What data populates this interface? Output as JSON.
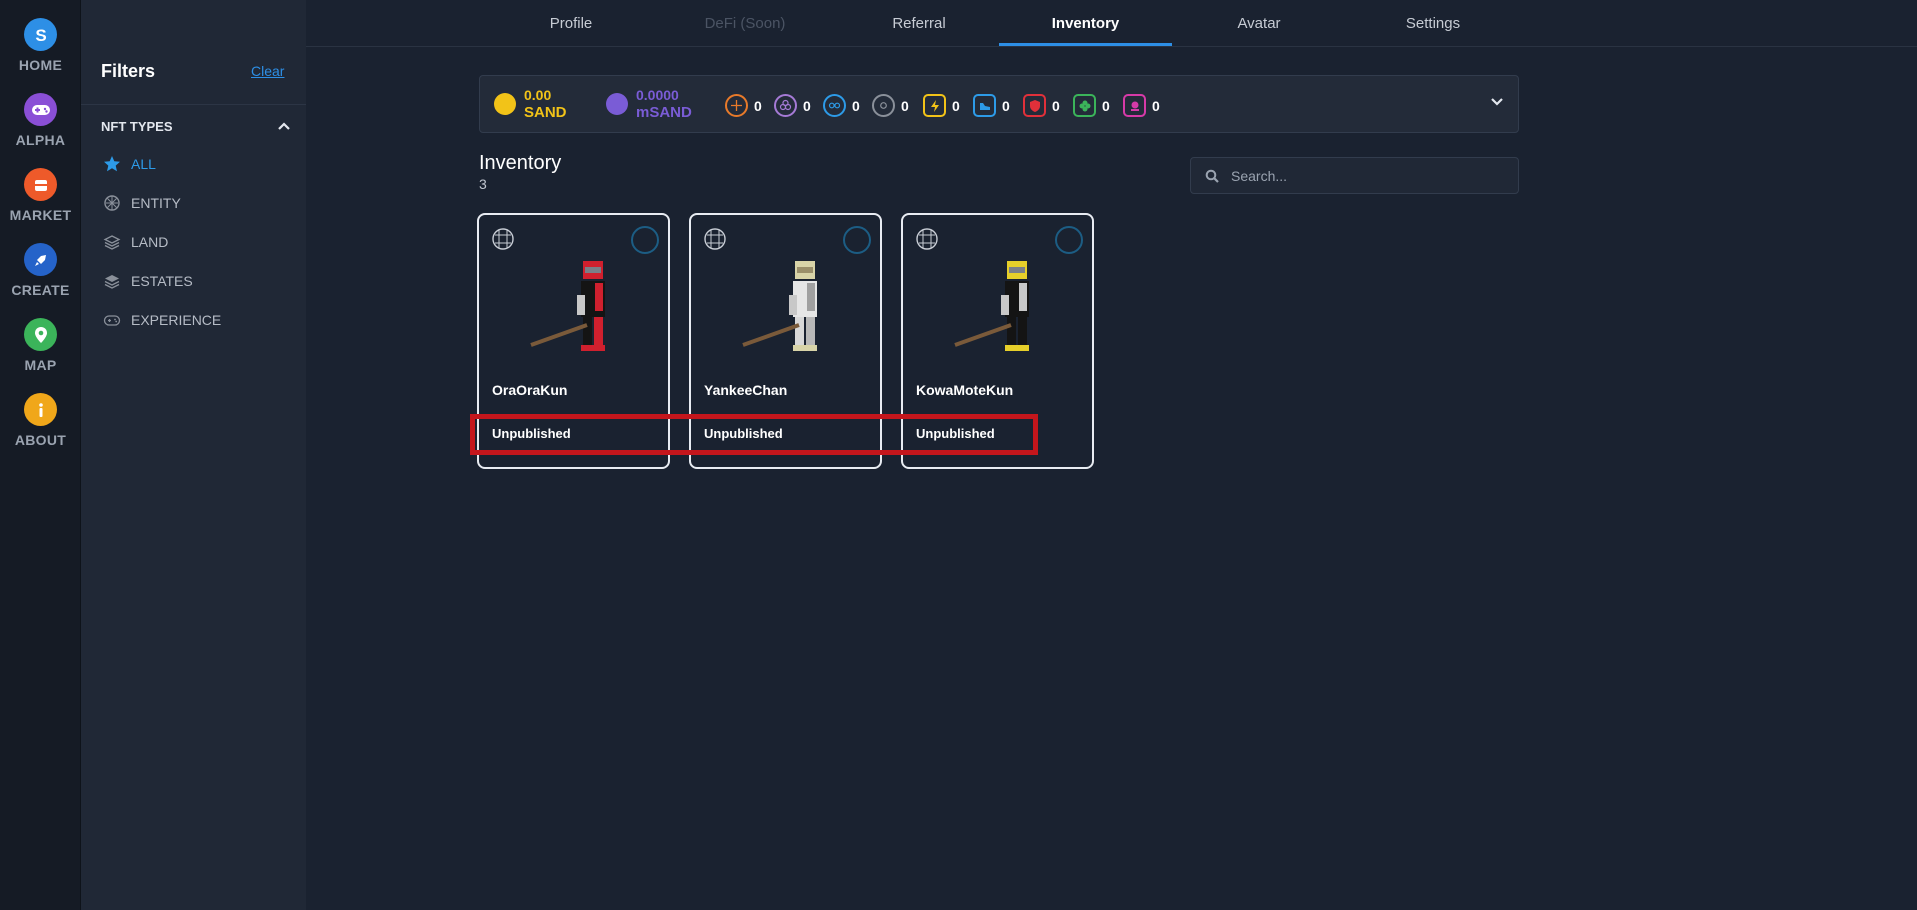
{
  "rail": {
    "items": [
      {
        "label": "HOME",
        "icon": "sandbox-logo-icon",
        "color": "#2d8fe6"
      },
      {
        "label": "ALPHA",
        "icon": "gamepad-icon",
        "color": "#8a4fd6"
      },
      {
        "label": "MARKET",
        "icon": "shop-icon",
        "color": "#ee5a2a"
      },
      {
        "label": "CREATE",
        "icon": "rocket-icon",
        "color": "#2563c9"
      },
      {
        "label": "MAP",
        "icon": "map-pin-icon",
        "color": "#3bb45a"
      },
      {
        "label": "ABOUT",
        "icon": "info-icon",
        "color": "#f0a71a"
      }
    ]
  },
  "filters": {
    "title": "Filters",
    "clear_label": "Clear",
    "section_title": "NFT TYPES",
    "types": [
      {
        "label": "ALL",
        "icon": "star-icon",
        "active": true
      },
      {
        "label": "ENTITY",
        "icon": "entity-icon",
        "active": false
      },
      {
        "label": "LAND",
        "icon": "land-icon",
        "active": false
      },
      {
        "label": "ESTATES",
        "icon": "estates-icon",
        "active": false
      },
      {
        "label": "EXPERIENCE",
        "icon": "gamepad-icon",
        "active": false
      }
    ]
  },
  "tabs": [
    {
      "label": "Profile",
      "state": "normal"
    },
    {
      "label": "DeFi (Soon)",
      "state": "disabled"
    },
    {
      "label": "Referral",
      "state": "normal"
    },
    {
      "label": "Inventory",
      "state": "active"
    },
    {
      "label": "Avatar",
      "state": "normal"
    },
    {
      "label": "Settings",
      "state": "normal"
    }
  ],
  "balance": {
    "sand_amount": "0.00",
    "sand_unit": "SAND",
    "sand_color": "#f2c318",
    "msand_amount": "0.0000",
    "msand_unit": "mSAND",
    "msand_color": "#7a5cd6",
    "gems": [
      {
        "icon": "orange-gem-icon",
        "color": "#e87a2a",
        "count": "0"
      },
      {
        "icon": "purple-gem-icon",
        "color": "#a57ad6",
        "count": "0"
      },
      {
        "icon": "blue-gem-icon",
        "color": "#2d9be8",
        "count": "0"
      },
      {
        "icon": "grey-gem-icon",
        "color": "#8a909a",
        "count": "0"
      },
      {
        "icon": "lightning-catalyst-icon",
        "color": "#f2c318",
        "count": "0"
      },
      {
        "icon": "shoe-catalyst-icon",
        "color": "#2d9be8",
        "count": "0"
      },
      {
        "icon": "shield-catalyst-icon",
        "color": "#e0303a",
        "count": "0"
      },
      {
        "icon": "clover-catalyst-icon",
        "color": "#3bb45a",
        "count": "0"
      },
      {
        "icon": "magic-catalyst-icon",
        "color": "#d63aa8",
        "count": "0"
      }
    ]
  },
  "inventory": {
    "title": "Inventory",
    "count": "3",
    "search_placeholder": "Search...",
    "items": [
      {
        "name": "OraOraKun",
        "status": "Unpublished",
        "accent": "#d0202e"
      },
      {
        "name": "YankeeChan",
        "status": "Unpublished",
        "accent": "#d8d4a8"
      },
      {
        "name": "KowaMoteKun",
        "status": "Unpublished",
        "accent": "#e6cf2a"
      }
    ]
  }
}
